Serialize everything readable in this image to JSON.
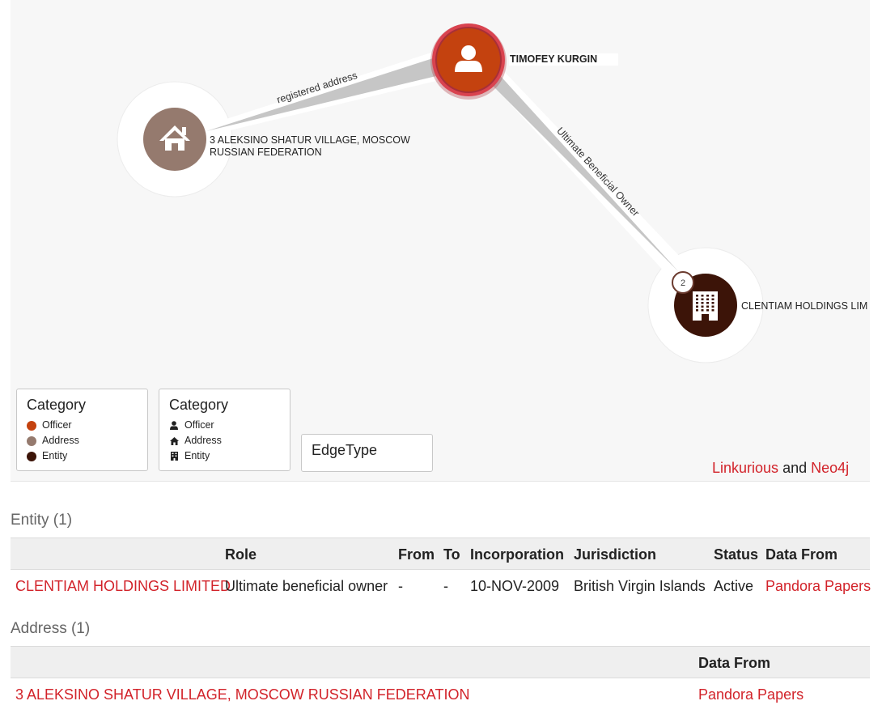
{
  "graph": {
    "nodes": {
      "officer": {
        "label": "TIMOFEY KURGIN",
        "category": "Officer",
        "color": "#c4420f",
        "icon": "user-icon"
      },
      "address": {
        "label_line1": "3 ALEKSINO SHATUR VILLAGE, MOSCOW",
        "label_line2": "RUSSIAN FEDERATION",
        "category": "Address",
        "color": "#957a6e",
        "icon": "home-icon"
      },
      "entity": {
        "label": "CLENTIAM HOLDINGS LIM",
        "category": "Entity",
        "color": "#3c1408",
        "icon": "building-icon",
        "badge": "2"
      }
    },
    "edges": {
      "officer_address": {
        "label": "registered address"
      },
      "officer_entity": {
        "label": "Ultimate Beneficial Owner"
      }
    }
  },
  "legend": {
    "color_box": {
      "title": "Category",
      "items": [
        {
          "label": "Officer",
          "color": "#c4420f"
        },
        {
          "label": "Address",
          "color": "#957a6e"
        },
        {
          "label": "Entity",
          "color": "#3c1408"
        }
      ]
    },
    "icon_box": {
      "title": "Category",
      "items": [
        {
          "label": "Officer",
          "icon": "user-icon"
        },
        {
          "label": "Address",
          "icon": "home-icon"
        },
        {
          "label": "Entity",
          "icon": "building-icon"
        }
      ]
    },
    "edge_box": {
      "title": "EdgeType"
    }
  },
  "credit": {
    "link1": "Linkurious",
    "and": "and",
    "link2": "Neo4j"
  },
  "entity_section": {
    "title": "Entity (1)",
    "headers": [
      "Role",
      "From",
      "To",
      "Incorporation",
      "Jurisdiction",
      "Status",
      "Data From"
    ],
    "row": {
      "name": "CLENTIAM HOLDINGS LIMITED",
      "role": "Ultimate beneficial owner",
      "from": "-",
      "to": "-",
      "incorporation": "10-NOV-2009",
      "jurisdiction": "British Virgin Islands",
      "status": "Active",
      "data_from": "Pandora Papers"
    }
  },
  "address_section": {
    "title": "Address (1)",
    "headers": [
      "Data From"
    ],
    "row": {
      "address": "3 ALEKSINO SHATUR VILLAGE, MOSCOW RUSSIAN FEDERATION",
      "data_from": "Pandora Papers"
    }
  },
  "colors": {
    "accent": "#d2232a",
    "officer_ring": "#d9434f"
  }
}
